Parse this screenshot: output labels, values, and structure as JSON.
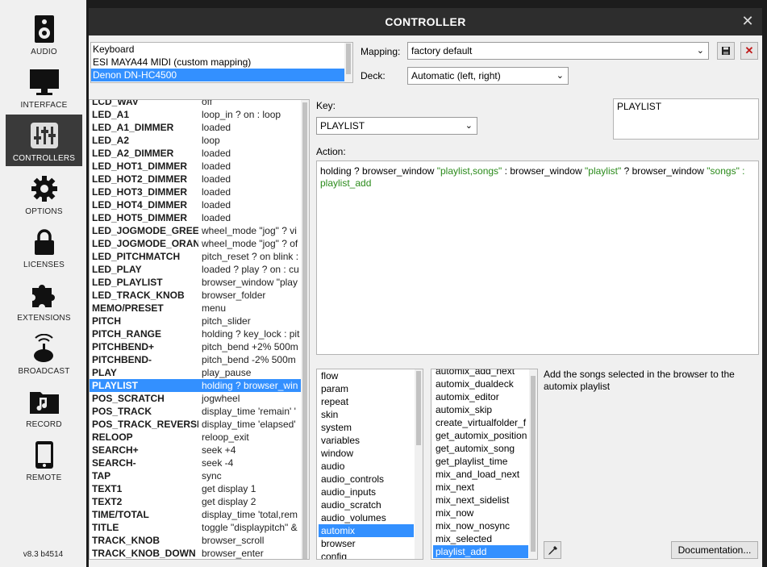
{
  "sidebar": {
    "items": [
      {
        "label": "AUDIO",
        "icon": "speaker-icon"
      },
      {
        "label": "INTERFACE",
        "icon": "monitor-icon"
      },
      {
        "label": "CONTROLLERS",
        "icon": "sliders-icon"
      },
      {
        "label": "OPTIONS",
        "icon": "gear-icon"
      },
      {
        "label": "LICENSES",
        "icon": "lock-icon"
      },
      {
        "label": "EXTENSIONS",
        "icon": "puzzle-icon"
      },
      {
        "label": "BROADCAST",
        "icon": "broadcast-icon"
      },
      {
        "label": "RECORD",
        "icon": "music-folder-icon"
      },
      {
        "label": "REMOTE",
        "icon": "phone-icon"
      }
    ],
    "active": "CONTROLLERS",
    "version": "v8.3 b4514"
  },
  "dialog": {
    "title": "CONTROLLER",
    "close": "✕"
  },
  "devices": [
    "Keyboard",
    "ESI MAYA44 MIDI (custom mapping)",
    "Denon DN-HC4500"
  ],
  "selected_device": "Denon DN-HC4500",
  "mapping": {
    "label": "Mapping:",
    "value": "factory default"
  },
  "deck": {
    "label": "Deck:",
    "value": "Automatic (left, right)"
  },
  "key": {
    "label": "Key:",
    "value": "PLAYLIST",
    "echo": "PLAYLIST"
  },
  "action": {
    "label": "Action:",
    "segments": [
      {
        "t": "holding ? browser_window ",
        "c": "n"
      },
      {
        "t": "\"playlist,songs\"",
        "c": "g"
      },
      {
        "t": " : browser_window ",
        "c": "n"
      },
      {
        "t": "\"playlist\"",
        "c": "g"
      },
      {
        "t": " ? browser_window ",
        "c": "n"
      },
      {
        "t": "\"songs\"",
        "c": "g"
      },
      {
        "t": " : playlist_add",
        "c": "g"
      }
    ]
  },
  "keys": [
    [
      "LCD_WAV",
      "off"
    ],
    [
      "LED_A1",
      "loop_in ? on : loop"
    ],
    [
      "LED_A1_DIMMER",
      "loaded"
    ],
    [
      "LED_A2",
      "loop"
    ],
    [
      "LED_A2_DIMMER",
      "loaded"
    ],
    [
      "LED_HOT1_DIMMER",
      "loaded"
    ],
    [
      "LED_HOT2_DIMMER",
      "loaded"
    ],
    [
      "LED_HOT3_DIMMER",
      "loaded"
    ],
    [
      "LED_HOT4_DIMMER",
      "loaded"
    ],
    [
      "LED_HOT5_DIMMER",
      "loaded"
    ],
    [
      "LED_JOGMODE_GREEN",
      "wheel_mode \"jog\" ? vi"
    ],
    [
      "LED_JOGMODE_ORANGE",
      "wheel_mode \"jog\" ? of"
    ],
    [
      "LED_PITCHMATCH",
      "pitch_reset ? on blink :"
    ],
    [
      "LED_PLAY",
      "loaded ? play ? on : cu"
    ],
    [
      "LED_PLAYLIST",
      "browser_window \"play"
    ],
    [
      "LED_TRACK_KNOB",
      "browser_folder"
    ],
    [
      "MEMO/PRESET",
      "menu"
    ],
    [
      "PITCH",
      "pitch_slider"
    ],
    [
      "PITCH_RANGE",
      "holding ? key_lock : pit"
    ],
    [
      "PITCHBEND+",
      "pitch_bend +2% 500m"
    ],
    [
      "PITCHBEND-",
      "pitch_bend -2% 500m"
    ],
    [
      "PLAY",
      "play_pause"
    ],
    [
      "PLAYLIST",
      "holding ? browser_win"
    ],
    [
      "POS_SCRATCH",
      "jogwheel"
    ],
    [
      "POS_TRACK",
      "display_time 'remain' '"
    ],
    [
      "POS_TRACK_REVERSE",
      "display_time 'elapsed'"
    ],
    [
      "RELOOP",
      "reloop_exit"
    ],
    [
      "SEARCH+",
      "seek +4"
    ],
    [
      "SEARCH-",
      "seek -4"
    ],
    [
      "TAP",
      "sync"
    ],
    [
      "TEXT1",
      "get display 1"
    ],
    [
      "TEXT2",
      "get display 2"
    ],
    [
      "TIME/TOTAL",
      "display_time 'total,rem"
    ],
    [
      "TITLE",
      "toggle \"displaypitch\" &"
    ],
    [
      "TRACK_KNOB",
      "browser_scroll"
    ],
    [
      "TRACK_KNOB_DOWN",
      "browser_enter"
    ]
  ],
  "selected_key": "PLAYLIST",
  "categories": [
    "flow",
    "param",
    "repeat",
    "skin",
    "system",
    "variables",
    "window",
    "audio",
    "audio_controls",
    "audio_inputs",
    "audio_scratch",
    "audio_volumes",
    "automix",
    "browser",
    "config"
  ],
  "selected_category": "automix",
  "functions": [
    "automix_add_next",
    "automix_dualdeck",
    "automix_editor",
    "automix_skip",
    "create_virtualfolder_f",
    "get_automix_position",
    "get_automix_song",
    "get_playlist_time",
    "mix_and_load_next",
    "mix_next",
    "mix_next_sidelist",
    "mix_now",
    "mix_now_nosync",
    "mix_selected",
    "playlist_add"
  ],
  "selected_function": "playlist_add",
  "description": "Add the songs selected in the browser to the automix playlist",
  "documentation_label": "Documentation...",
  "colors": {
    "selection": "#3390ff",
    "green_text": "#2a8a1a",
    "titlebar": "#2d2d2d",
    "sidebar_active": "#3a3a3a"
  }
}
